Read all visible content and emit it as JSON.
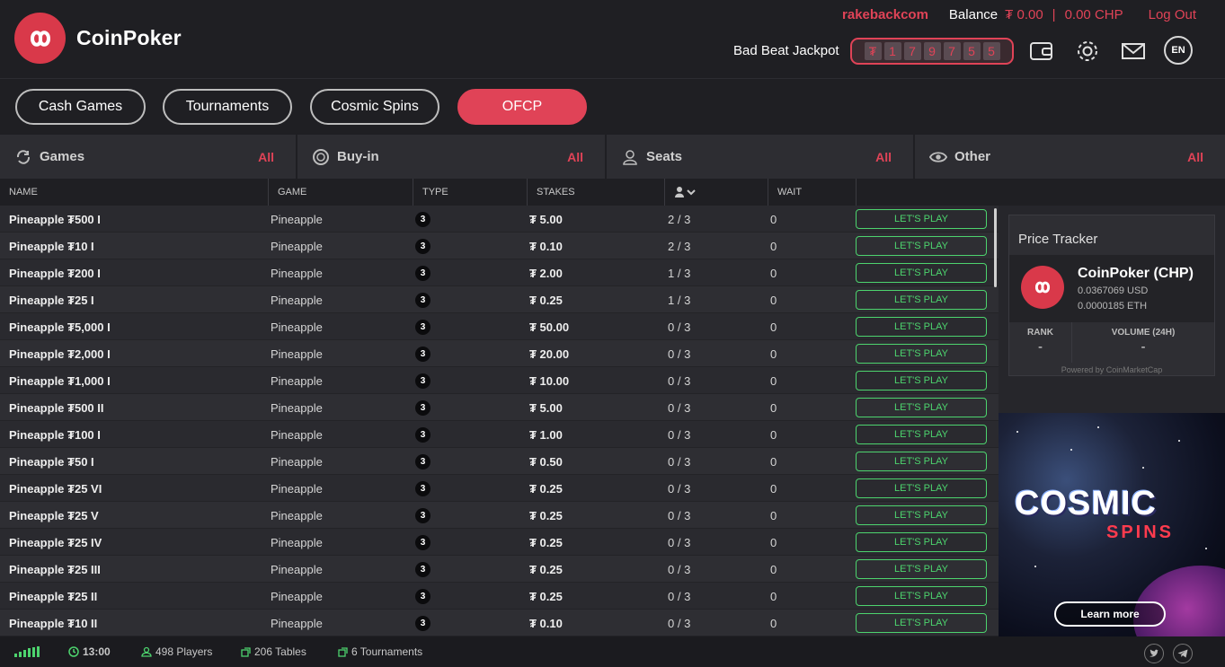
{
  "brand": {
    "name": "CoinPoker"
  },
  "header": {
    "rakeback": "rakebackcom",
    "balance_label": "Balance",
    "balance_fiat": "₮ 0.00",
    "balance_sep": "|",
    "balance_chp": "0.00 CHP",
    "logout": "Log Out",
    "jackpot_label": "Bad Beat Jackpot",
    "jackpot_digits": [
      "₮",
      "1",
      "7",
      "9",
      "7",
      "5",
      "5"
    ],
    "language": "EN"
  },
  "tabs": [
    {
      "label": "Cash Games",
      "active": false
    },
    {
      "label": "Tournaments",
      "active": false
    },
    {
      "label": "Cosmic Spins",
      "active": false
    },
    {
      "label": "OFCP",
      "active": true
    }
  ],
  "filters": [
    {
      "label": "Games",
      "value": "All",
      "icon": "refresh-icon"
    },
    {
      "label": "Buy-in",
      "value": "All",
      "icon": "chip-icon"
    },
    {
      "label": "Seats",
      "value": "All",
      "icon": "user-icon"
    },
    {
      "label": "Other",
      "value": "All",
      "icon": "eye-icon"
    }
  ],
  "table": {
    "headers": {
      "name": "NAME",
      "game": "GAME",
      "type": "TYPE",
      "stakes": "STAKES",
      "wait": "WAIT"
    },
    "play_label": "LET'S PLAY",
    "rows": [
      {
        "name": "Pineapple ₮500 I",
        "game": "Pineapple",
        "type": "3",
        "stakes": "₮ 5.00",
        "seats": "2 / 3",
        "wait": "0"
      },
      {
        "name": "Pineapple ₮10 I",
        "game": "Pineapple",
        "type": "3",
        "stakes": "₮ 0.10",
        "seats": "2 / 3",
        "wait": "0"
      },
      {
        "name": "Pineapple ₮200 I",
        "game": "Pineapple",
        "type": "3",
        "stakes": "₮ 2.00",
        "seats": "1 / 3",
        "wait": "0"
      },
      {
        "name": "Pineapple ₮25 I",
        "game": "Pineapple",
        "type": "3",
        "stakes": "₮ 0.25",
        "seats": "1 / 3",
        "wait": "0"
      },
      {
        "name": "Pineapple ₮5,000 I",
        "game": "Pineapple",
        "type": "3",
        "stakes": "₮ 50.00",
        "seats": "0 / 3",
        "wait": "0"
      },
      {
        "name": "Pineapple ₮2,000 I",
        "game": "Pineapple",
        "type": "3",
        "stakes": "₮ 20.00",
        "seats": "0 / 3",
        "wait": "0"
      },
      {
        "name": "Pineapple ₮1,000 I",
        "game": "Pineapple",
        "type": "3",
        "stakes": "₮ 10.00",
        "seats": "0 / 3",
        "wait": "0"
      },
      {
        "name": "Pineapple ₮500 II",
        "game": "Pineapple",
        "type": "3",
        "stakes": "₮ 5.00",
        "seats": "0 / 3",
        "wait": "0"
      },
      {
        "name": "Pineapple ₮100 I",
        "game": "Pineapple",
        "type": "3",
        "stakes": "₮ 1.00",
        "seats": "0 / 3",
        "wait": "0"
      },
      {
        "name": "Pineapple ₮50 I",
        "game": "Pineapple",
        "type": "3",
        "stakes": "₮ 0.50",
        "seats": "0 / 3",
        "wait": "0"
      },
      {
        "name": "Pineapple ₮25 VI",
        "game": "Pineapple",
        "type": "3",
        "stakes": "₮ 0.25",
        "seats": "0 / 3",
        "wait": "0"
      },
      {
        "name": "Pineapple ₮25 V",
        "game": "Pineapple",
        "type": "3",
        "stakes": "₮ 0.25",
        "seats": "0 / 3",
        "wait": "0"
      },
      {
        "name": "Pineapple ₮25 IV",
        "game": "Pineapple",
        "type": "3",
        "stakes": "₮ 0.25",
        "seats": "0 / 3",
        "wait": "0"
      },
      {
        "name": "Pineapple ₮25 III",
        "game": "Pineapple",
        "type": "3",
        "stakes": "₮ 0.25",
        "seats": "0 / 3",
        "wait": "0"
      },
      {
        "name": "Pineapple ₮25 II",
        "game": "Pineapple",
        "type": "3",
        "stakes": "₮ 0.25",
        "seats": "0 / 3",
        "wait": "0"
      },
      {
        "name": "Pineapple ₮10 II",
        "game": "Pineapple",
        "type": "3",
        "stakes": "₮ 0.10",
        "seats": "0 / 3",
        "wait": "0"
      }
    ]
  },
  "tracker": {
    "title": "Price Tracker",
    "coin": "CoinPoker (CHP)",
    "usd": "0.0367069 USD",
    "eth": "0.0000185 ETH",
    "rank_label": "RANK",
    "rank_value": "-",
    "volume_label": "VOLUME (24H)",
    "volume_value": "-",
    "powered": "Powered by CoinMarketCap"
  },
  "banner": {
    "title": "COSMIC",
    "subtitle": "SPINS",
    "cta": "Learn more"
  },
  "status": {
    "time": "13:00",
    "players": "498 Players",
    "tables": "206 Tables",
    "tournaments": "6 Tournaments"
  },
  "colors": {
    "accent": "#e04357",
    "play": "#4dd46e"
  }
}
